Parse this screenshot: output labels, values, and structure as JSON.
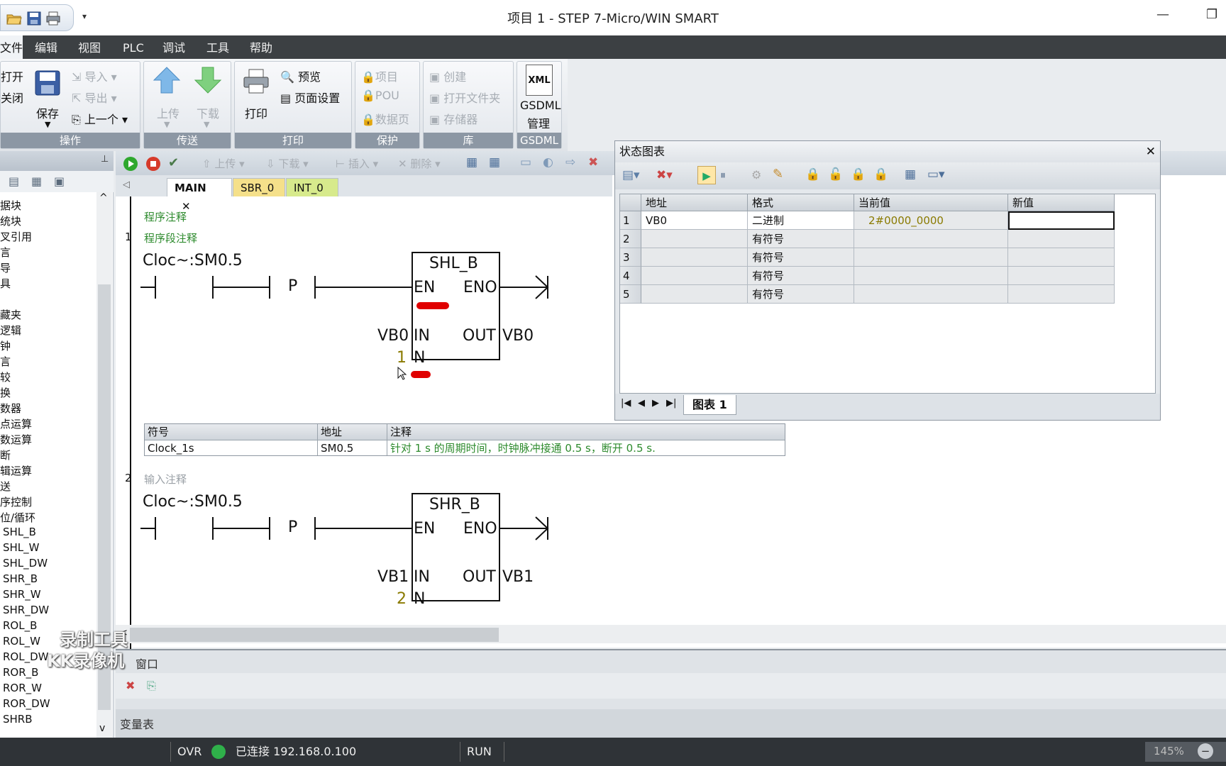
{
  "window": {
    "title": "项目 1 - STEP 7-Micro/WIN SMART"
  },
  "menu": {
    "file": "文件",
    "edit": "编辑",
    "view": "视图",
    "plc": "PLC",
    "debug": "调试",
    "tools": "工具",
    "help": "帮助"
  },
  "ribbon": {
    "ops": {
      "open": "打开",
      "close": "关闭",
      "save": "保存",
      "import": "导入",
      "export": "导出",
      "prev": "上一个",
      "label": "操作"
    },
    "transfer": {
      "upload": "上传",
      "download": "下载",
      "label": "传送"
    },
    "print": {
      "print": "打印",
      "preview": "预览",
      "page_setup": "页面设置",
      "label": "打印"
    },
    "protect": {
      "project": "项目",
      "pou": "POU",
      "data_page": "数据页",
      "label": "保护"
    },
    "library": {
      "create": "创建",
      "open_folder": "打开文件夹",
      "memory": "存储器",
      "label": "库"
    },
    "gsdml": {
      "icon_text": "XML",
      "manage1": "GSDML",
      "manage2": "管理",
      "label": "GSDML"
    }
  },
  "tree": {
    "items": [
      "据块",
      "统块",
      "叉引用",
      "言",
      "导",
      "具",
      "藏夹",
      "逻辑",
      "钟",
      "言",
      "较",
      "换",
      "数器",
      "点运算",
      "数运算",
      "断",
      "辑运算",
      "送",
      "序控制",
      "位/循环"
    ],
    "leaf_items": [
      "SHL_B",
      "SHL_W",
      "SHL_DW",
      "SHR_B",
      "SHR_W",
      "SHR_DW",
      "ROL_B",
      "ROL_W",
      "ROL_DW",
      "ROR_B",
      "ROR_W",
      "ROR_DW",
      "SHRB"
    ]
  },
  "editor_toolbar": {
    "upload": "上传",
    "download": "下载",
    "insert": "插入",
    "delete": "删除"
  },
  "tabs": {
    "main": "MAIN",
    "sbr": "SBR_0",
    "int": "INT_0"
  },
  "program": {
    "comment": "程序注释",
    "networks": [
      {
        "num": "1",
        "comment": "程序段注释",
        "contact": "Cloc~:SM0.5",
        "p": "P",
        "block": "SHL_B",
        "en": "EN",
        "eno": "ENO",
        "in_pin": "IN",
        "out_pin": "OUT",
        "n_pin": "N",
        "in_val": "VB0",
        "out_val": "VB0",
        "n_val": "1"
      },
      {
        "num": "2",
        "comment": "输入注释",
        "contact": "Cloc~:SM0.5",
        "p": "P",
        "block": "SHR_B",
        "en": "EN",
        "eno": "ENO",
        "in_pin": "IN",
        "out_pin": "OUT",
        "n_pin": "N",
        "in_val": "VB1",
        "out_val": "VB1",
        "n_val": "2"
      }
    ]
  },
  "symbol_table": {
    "headers": [
      "符号",
      "地址",
      "注释"
    ],
    "row": [
      "Clock_1s",
      "SM0.5",
      "针对 1 s 的周期时间，时钟脉冲接通 0.5 s，断开 0.5 s."
    ]
  },
  "status_chart": {
    "title": "状态图表",
    "headers": [
      "地址",
      "格式",
      "当前值",
      "新值"
    ],
    "rows": [
      {
        "n": "1",
        "addr": "VB0",
        "fmt": "二进制",
        "cur": "2#0000_0000",
        "new": ""
      },
      {
        "n": "2",
        "addr": "",
        "fmt": "有符号",
        "cur": "",
        "new": ""
      },
      {
        "n": "3",
        "addr": "",
        "fmt": "有符号",
        "cur": "",
        "new": ""
      },
      {
        "n": "4",
        "addr": "",
        "fmt": "有符号",
        "cur": "",
        "new": ""
      },
      {
        "n": "5",
        "addr": "",
        "fmt": "有符号",
        "cur": "",
        "new": ""
      }
    ],
    "sheet_tab": "图表 1"
  },
  "panes": {
    "output": "窗口",
    "vartable": "变量表"
  },
  "statusbar": {
    "ovr": "OVR",
    "connection": "已连接 192.168.0.100",
    "mode": "RUN",
    "zoom": "145%"
  },
  "watermark": {
    "line1": "录制工具",
    "line2": "KK录像机"
  },
  "colors": {
    "menu_bg": "#3c4043",
    "green": "#2e8b2e",
    "number": "#8a7a00",
    "annotation_red": "#e00000"
  }
}
